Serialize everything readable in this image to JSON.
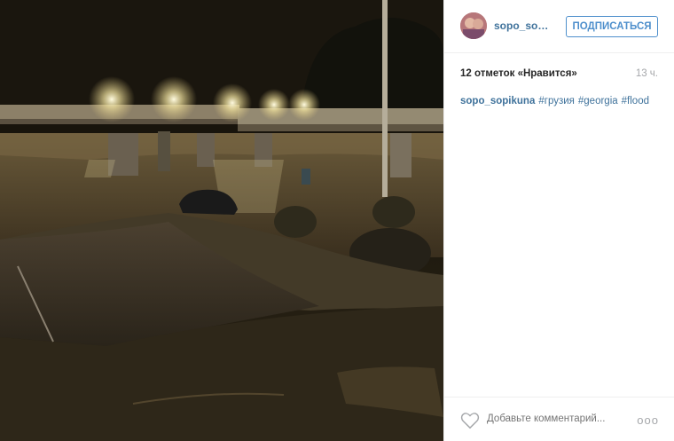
{
  "post": {
    "username": "sopo_sopi...",
    "follow_label": "ПОДПИСАТЬСЯ",
    "likes_text": "12 отметок «Нравится»",
    "time_ago": "13 ч.",
    "caption_user": "sopo_sopikuna",
    "hashtags": [
      "#грузия",
      "#georgia",
      "#flood"
    ],
    "comment_placeholder": "Добавьте комментарий...",
    "more_label": "ooo"
  },
  "icons": {
    "like": "heart-icon",
    "options": "more-options-icon"
  },
  "colors": {
    "link": "#3f729b",
    "follow_button": "#4e8fcc",
    "muted": "#a5a7aa",
    "text": "#262626"
  }
}
